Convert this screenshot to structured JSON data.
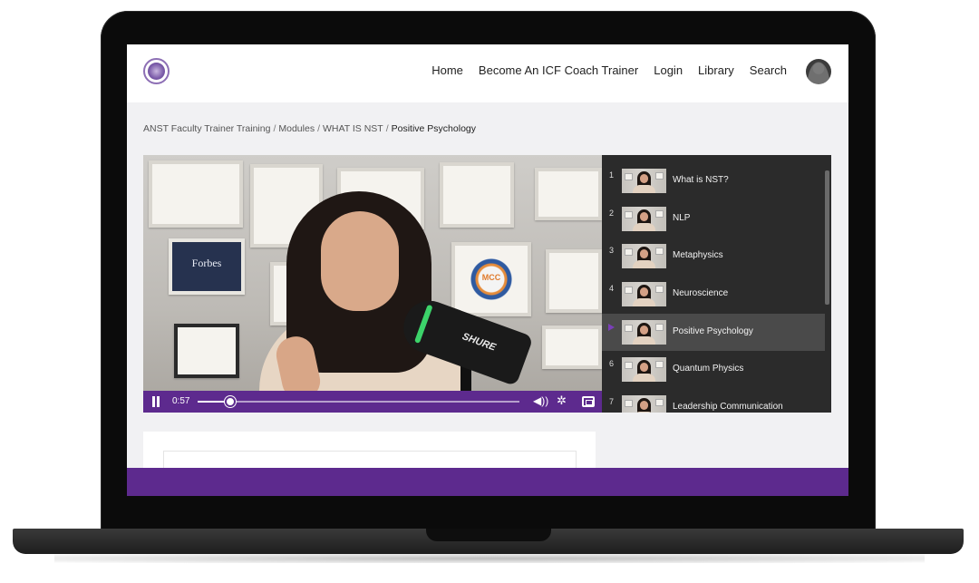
{
  "header": {
    "nav": [
      "Home",
      "Become An ICF Coach Trainer",
      "Login",
      "Library",
      "Search"
    ]
  },
  "breadcrumb": {
    "items": [
      "ANST Faculty Trainer Training",
      "Modules",
      "WHAT IS NST"
    ],
    "current": "Positive Psychology",
    "separator": "/"
  },
  "video": {
    "time": "0:57",
    "progress": 0.1,
    "state": "playing",
    "scene_text": {
      "forbes": "Forbes",
      "seal": "MCC",
      "mic_brand": "SHURE"
    },
    "icons": [
      "pause-icon",
      "volume-icon",
      "settings-gear-icon",
      "fullscreen-icon"
    ]
  },
  "playlist": {
    "active_index": 4,
    "items": [
      {
        "number": "1",
        "title": "What is NST?"
      },
      {
        "number": "2",
        "title": "NLP"
      },
      {
        "number": "3",
        "title": "Metaphysics"
      },
      {
        "number": "4",
        "title": "Neuroscience"
      },
      {
        "number": "",
        "title": "Positive Psychology"
      },
      {
        "number": "6",
        "title": "Quantum Physics"
      },
      {
        "number": "7",
        "title": "Leadership Communication"
      }
    ]
  },
  "colors": {
    "brand_purple": "#5d2a8e",
    "playlist_bg": "#2b2b2b",
    "playlist_active": "#4a4a4a",
    "active_marker": "#7a3fb8"
  }
}
